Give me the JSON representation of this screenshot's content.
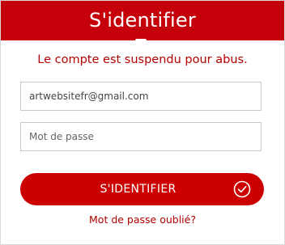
{
  "header": {
    "title": "S'identifier"
  },
  "error_message": "Le compte est suspendu pour abus.",
  "form": {
    "email_value": "artwebsitefr@gmail.com",
    "password_placeholder": "Mot de passe",
    "submit_label": "S'IDENTIFIER",
    "forgot_password_label": "Mot de passe oublié?"
  },
  "icons": {
    "submit": "check-circle-icon"
  },
  "colors": {
    "brand_red": "#c6000b",
    "button_red": "#cc0000",
    "error_text": "#b40000",
    "field_border": "#c8c8c8"
  }
}
